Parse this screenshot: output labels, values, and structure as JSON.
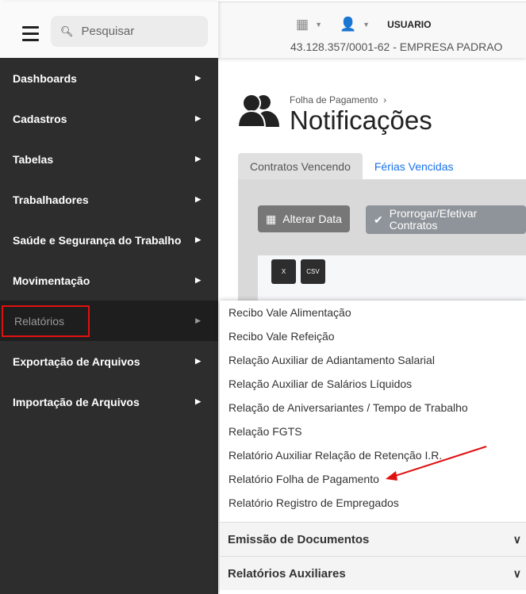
{
  "header": {
    "search_placeholder": "Pesquisar",
    "user": "USUARIO",
    "empresa": "43.128.357/0001-62 - EMPRESA PADRAO"
  },
  "sidebar": {
    "items": [
      {
        "label": "Dashboards"
      },
      {
        "label": "Cadastros"
      },
      {
        "label": "Tabelas"
      },
      {
        "label": "Trabalhadores"
      },
      {
        "label": "Saúde e Segurança do Trabalho"
      },
      {
        "label": "Movimentação"
      },
      {
        "label": "Relatórios",
        "active": true
      },
      {
        "label": "Exportação de Arquivos"
      },
      {
        "label": "Importação de Arquivos"
      }
    ]
  },
  "page": {
    "breadcrumb": "Folha de Pagamento",
    "title": "Notificações",
    "tabs": [
      {
        "label": "Contratos Vencendo",
        "active": true
      },
      {
        "label": "Férias Vencidas"
      }
    ],
    "buttons": {
      "alterar": "Alterar Data",
      "prorrogar": "Prorrogar/Efetivar Contratos"
    },
    "export": {
      "excel": "X",
      "csv": "CSV"
    }
  },
  "submenu": {
    "items": [
      "Recibo Vale Alimentação",
      "Recibo Vale Refeição",
      "Relação Auxiliar de Adiantamento Salarial",
      "Relação Auxiliar de Salários Líquidos",
      "Relação de Aniversariantes / Tempo de Trabalho",
      "Relação FGTS",
      "Relatório Auxiliar Relação de Retenção I.R.",
      "Relatório Folha de Pagamento",
      "Relatório Registro de Empregados"
    ],
    "sections": [
      "Emissão de Documentos",
      "Relatórios Auxiliares"
    ]
  },
  "colors": {
    "sidebar": "#2d2d2d",
    "highlight": "#e01010",
    "link": "#1a73e8"
  }
}
